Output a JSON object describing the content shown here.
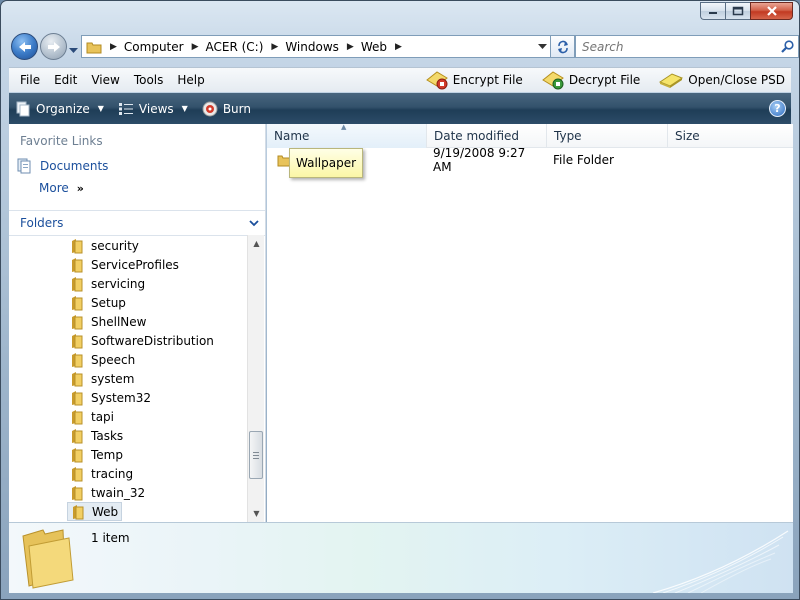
{
  "window": {
    "caption_buttons": [
      "minimize",
      "maximize",
      "close"
    ]
  },
  "address_bar": {
    "breadcrumbs": [
      "Computer",
      "ACER (C:)",
      "Windows",
      "Web"
    ],
    "search_placeholder": "Search"
  },
  "menu": {
    "items": [
      "File",
      "Edit",
      "View",
      "Tools",
      "Help"
    ],
    "tools": [
      {
        "label": "Encrypt File",
        "icon": "encrypt-file-icon"
      },
      {
        "label": "Decrypt File",
        "icon": "decrypt-file-icon"
      },
      {
        "label": "Open/Close PSD",
        "icon": "psd-drive-icon"
      }
    ]
  },
  "commandbar": {
    "organize": "Organize",
    "views": "Views",
    "burn": "Burn",
    "help": "?"
  },
  "nav": {
    "favorite_links_title": "Favorite Links",
    "favorites": [
      {
        "label": "Documents",
        "icon": "documents-icon"
      }
    ],
    "more_label": "More",
    "more_chevron": "»",
    "folders_title": "Folders",
    "tree": [
      "security",
      "ServiceProfiles",
      "servicing",
      "Setup",
      "ShellNew",
      "SoftwareDistribution",
      "Speech",
      "system",
      "System32",
      "tapi",
      "Tasks",
      "Temp",
      "tracing",
      "twain_32",
      "Web"
    ],
    "selected": "Web"
  },
  "files": {
    "columns": {
      "name": "Name",
      "date": "Date modified",
      "type": "Type",
      "size": "Size"
    },
    "sort_column": "Name",
    "rows": [
      {
        "name": "Wallpaper",
        "date": "9/19/2008 9:27 AM",
        "type": "File Folder",
        "size": ""
      }
    ]
  },
  "details": {
    "count": "1 item"
  },
  "colors": {
    "link": "#1b4f9c",
    "command_bar": "#2c4c68",
    "tooltip": "#fbf6a6",
    "close_button": "#c23a22"
  }
}
